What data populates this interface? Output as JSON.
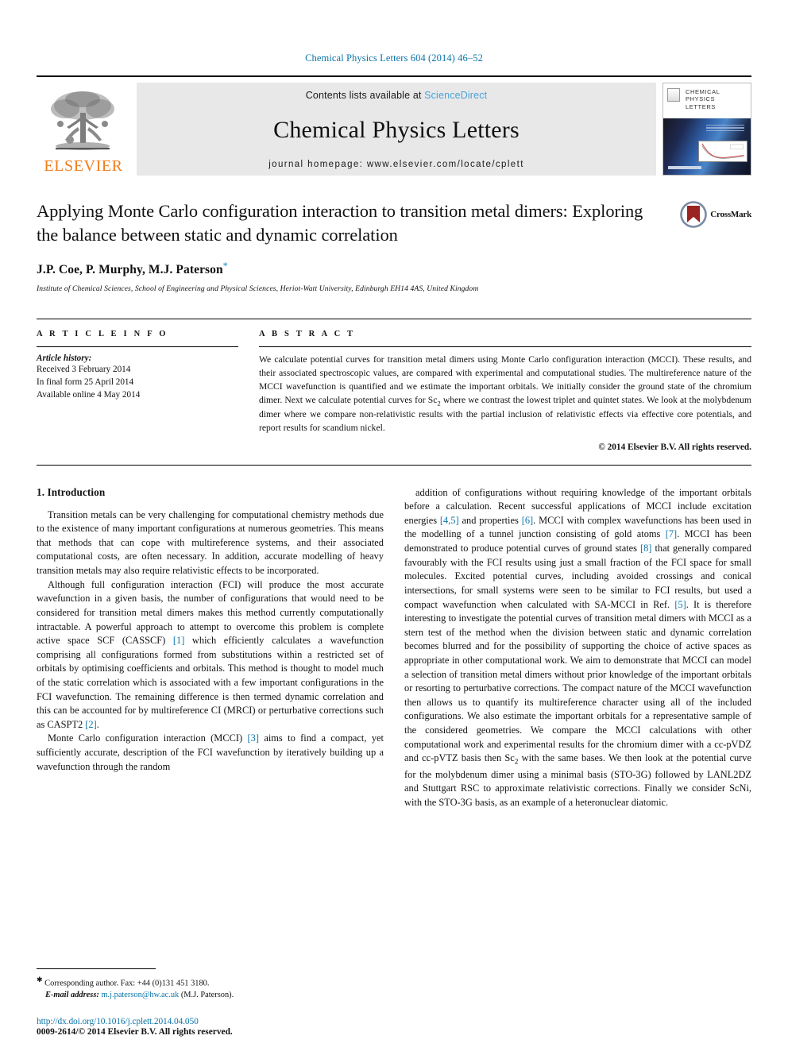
{
  "running_head": "Chemical Physics Letters 604 (2014) 46–52",
  "masthead": {
    "publisher_name": "ELSEVIER",
    "contents_prefix": "Contents lists available at",
    "contents_link": "ScienceDirect",
    "journal_title": "Chemical Physics Letters",
    "homepage_line": "journal homepage: www.elsevier.com/locate/cplett",
    "cover_title_line1": "CHEMICAL",
    "cover_title_line2": "PHYSICS",
    "cover_title_line3": "LETTERS"
  },
  "article": {
    "title": "Applying Monte Carlo configuration interaction to transition metal dimers: Exploring the balance between static and dynamic correlation",
    "authors": "J.P. Coe, P. Murphy, M.J. Paterson",
    "corresponding_marker": "*",
    "affiliation": "Institute of Chemical Sciences, School of Engineering and Physical Sciences, Heriot-Watt University, Edinburgh EH14 4AS, United Kingdom",
    "crossmark_label": "CrossMark"
  },
  "info": {
    "section_label": "A R T I C L E    I N F O",
    "history_title": "Article history:",
    "history": [
      "Received 3 February 2014",
      "In final form 25 April 2014",
      "Available online 4 May 2014"
    ]
  },
  "abstract": {
    "section_label": "A B S T R A C T",
    "text": "We calculate potential curves for transition metal dimers using Monte Carlo configuration interaction (MCCI). These results, and their associated spectroscopic values, are compared with experimental and computational studies. The multireference nature of the MCCI wavefunction is quantified and we estimate the important orbitals. We initially consider the ground state of the chromium dimer. Next we calculate potential curves for Sc2 where we contrast the lowest triplet and quintet states. We look at the molybdenum dimer where we compare non-relativistic results with the partial inclusion of relativistic effects via effective core potentials, and report results for scandium nickel.",
    "copyright": "© 2014 Elsevier B.V. All rights reserved."
  },
  "body": {
    "section_heading": "1. Introduction",
    "left_paragraphs": [
      "Transition metals can be very challenging for computational chemistry methods due to the existence of many important configurations at numerous geometries. This means that methods that can cope with multireference systems, and their associated computational costs, are often necessary. In addition, accurate modelling of heavy transition metals may also require relativistic effects to be incorporated.",
      "Although full configuration interaction (FCI) will produce the most accurate wavefunction in a given basis, the number of configurations that would need to be considered for transition metal dimers makes this method currently computationally intractable. A powerful approach to attempt to overcome this problem is complete active space SCF (CASSCF) [1] which efficiently calculates a wavefunction comprising all configurations formed from substitutions within a restricted set of orbitals by optimising coefficients and orbitals. This method is thought to model much of the static correlation which is associated with a few important configurations in the FCI wavefunction. The remaining difference is then termed dynamic correlation and this can be accounted for by multireference CI (MRCI) or perturbative corrections such as CASPT2 [2].",
      "Monte Carlo configuration interaction (MCCI) [3] aims to find a compact, yet sufficiently accurate, description of the FCI wavefunction by iteratively building up a wavefunction through the random"
    ],
    "right_paragraphs": [
      "addition of configurations without requiring knowledge of the important orbitals before a calculation. Recent successful applications of MCCI include excitation energies [4,5] and properties [6]. MCCI with complex wavefunctions has been used in the modelling of a tunnel junction consisting of gold atoms [7]. MCCI has been demonstrated to produce potential curves of ground states [8] that generally compared favourably with the FCI results using just a small fraction of the FCI space for small molecules. Excited potential curves, including avoided crossings and conical intersections, for small systems were seen to be similar to FCI results, but used a compact wavefunction when calculated with SA-MCCI in Ref. [5]. It is therefore interesting to investigate the potential curves of transition metal dimers with MCCI as a stern test of the method when the division between static and dynamic correlation becomes blurred and for the possibility of supporting the choice of active spaces as appropriate in other computational work. We aim to demonstrate that MCCI can model a selection of transition metal dimers without prior knowledge of the important orbitals or resorting to perturbative corrections. The compact nature of the MCCI wavefunction then allows us to quantify its multireference character using all of the included configurations. We also estimate the important orbitals for a representative sample of the considered geometries. We compare the MCCI calculations with other computational work and experimental results for the chromium dimer with a cc-pVDZ and cc-pVTZ basis then Sc2 with the same bases. We then look at the potential curve for the molybdenum dimer using a minimal basis (STO-3G) followed by LANL2DZ and Stuttgart RSC to approximate relativistic corrections. Finally we consider ScNi, with the STO-3G basis, as an example of a heteronuclear diatomic."
    ]
  },
  "footnote": {
    "corresponding": "Corresponding author. Fax: +44 (0)131 451 3180.",
    "email_label": "E-mail address:",
    "email": "m.j.paterson@hw.ac.uk",
    "email_suffix": "(M.J. Paterson)."
  },
  "bottom": {
    "doi": "http://dx.doi.org/10.1016/j.cplett.2014.04.050",
    "issn_line": "0009-2614/© 2014 Elsevier B.V. All rights reserved."
  },
  "colors": {
    "link_blue": "#0b74a8",
    "science_direct_blue": "#4aa3d8",
    "elsevier_orange": "#f07c1a",
    "masthead_gray": "#e8e8e8",
    "crossmark_red": "#9b2423"
  }
}
